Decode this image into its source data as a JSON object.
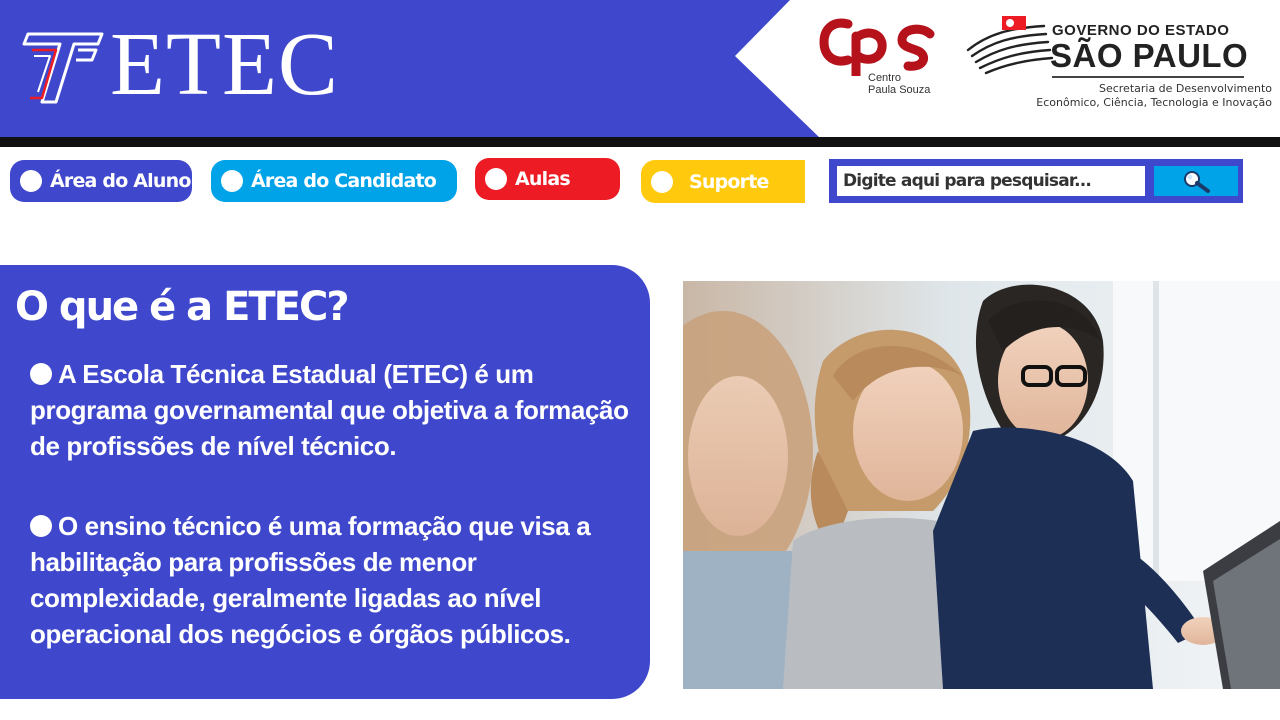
{
  "header": {
    "logo_text": "ETEC",
    "cps": {
      "mark": "cps",
      "caption_line1": "Centro",
      "caption_line2": "Paula Souza"
    },
    "government": {
      "line1": "GOVERNO DO ESTADO",
      "line2": "SÃO PAULO",
      "secretariat_line1": "Secretaria de Desenvolvimento",
      "secretariat_line2": "Econômico, Ciência, Tecnologia e Inovação"
    }
  },
  "nav": {
    "items": [
      {
        "label": "Área do Aluno",
        "color": "#3f48cc"
      },
      {
        "label": "Área do Candidato",
        "color": "#00a2e8"
      },
      {
        "label": "Aulas",
        "color": "#ed1c24"
      },
      {
        "label": "Suporte",
        "color": "#ffc90e"
      }
    ],
    "search": {
      "placeholder": "Digite aqui para pesquisar...",
      "button_icon": "magnifier-icon"
    }
  },
  "main": {
    "title": "O que é a ETEC?",
    "paragraphs": [
      "A Escola Técnica Estadual (ETEC) é um programa governamental que objetiva a formação de profissões de nível técnico.",
      "O ensino técnico é uma formação que visa a habilitação para profissões de menor complexidade, geralmente ligadas ao nível operacional dos negócios e órgãos públicos."
    ]
  },
  "colors": {
    "primary_blue": "#3f48cc",
    "cyan": "#00a2e8",
    "red": "#ed1c24",
    "yellow": "#ffc90e",
    "cps_red": "#b5121b"
  }
}
